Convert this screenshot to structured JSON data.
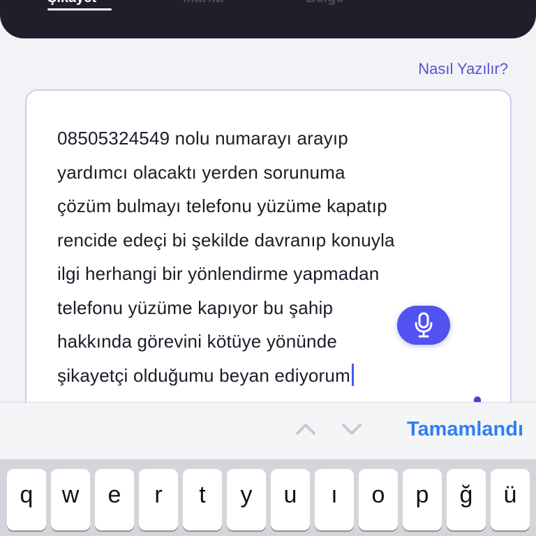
{
  "top_tabs": {
    "items": [
      {
        "label": "Şikayet",
        "active": true
      },
      {
        "label": "Marka",
        "active": false
      },
      {
        "label": "Belge",
        "active": false
      }
    ]
  },
  "howto_link": "Nasıl Yazılır?",
  "editor": {
    "value": "08505324549 nolu numarayı arayıp\nyardımcı olacaktı yerden sorunuma\nçözüm bulmayı telefonu yüzüme kapatıp\nrencide edeçi bi şekilde davranıp konuyla\nilgi herhangi bir yönlendirme yapmadan\ntelefonu yüzüme kapıyor bu şahip\nhakkında görevini kötüye yönünde\nşikayetçi olduğumu beyan ediyorum"
  },
  "mic_button": {
    "icon": "microphone-icon"
  },
  "accessory": {
    "prev_icon": "chevron-up-icon",
    "next_icon": "chevron-down-icon",
    "done_label": "Tamamlandı"
  },
  "keyboard": {
    "row1": [
      "q",
      "w",
      "e",
      "r",
      "t",
      "y",
      "u",
      "ı",
      "o",
      "p",
      "ğ",
      "ü"
    ]
  },
  "colors": {
    "accent": "#5252f0",
    "link": "#5d4fd0",
    "done": "#2f7ff0",
    "tabbar": "#1e1f2b"
  }
}
